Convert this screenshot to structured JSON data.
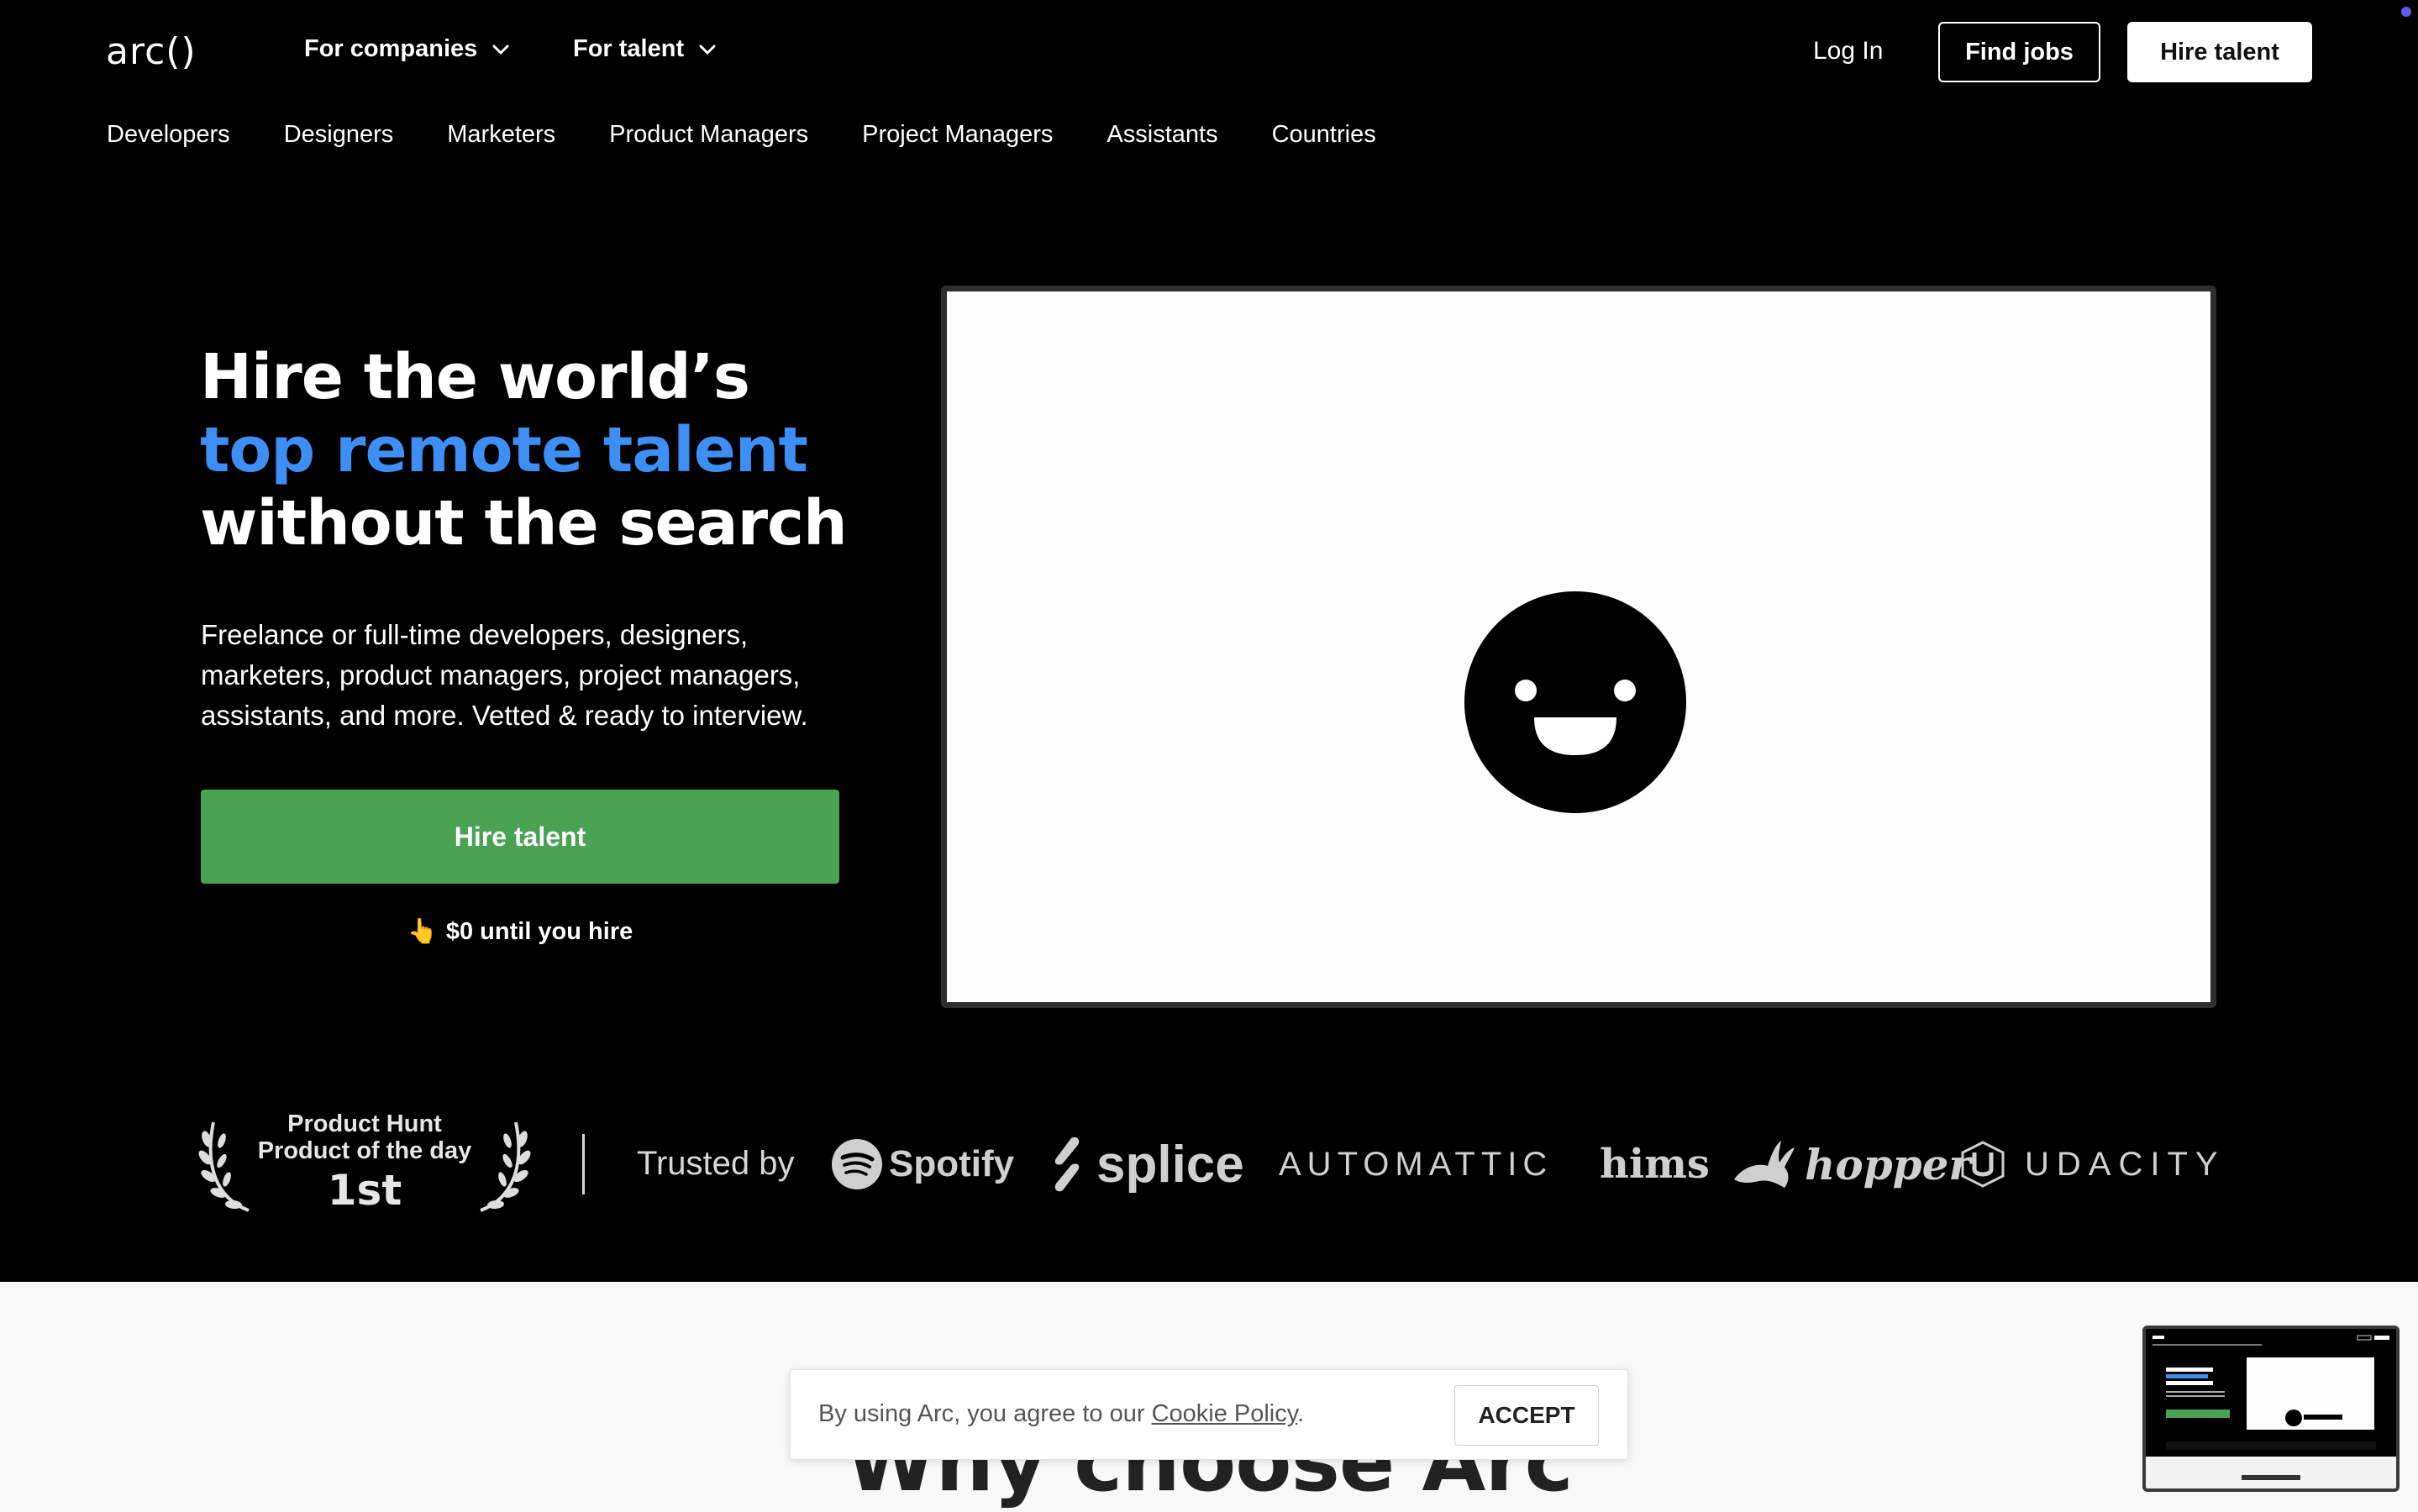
{
  "header": {
    "logo": "arc()",
    "nav_companies": "For companies",
    "nav_talent": "For talent",
    "login": "Log In",
    "find_jobs": "Find jobs",
    "hire_talent": "Hire talent"
  },
  "subnav": [
    "Developers",
    "Designers",
    "Marketers",
    "Product Managers",
    "Project Managers",
    "Assistants",
    "Countries"
  ],
  "hero": {
    "title_line1": "Hire the world’s",
    "title_line2": "top remote talent",
    "title_line3": "without the search",
    "description": "Freelance or full-time developers, designers, marketers, product managers, project managers, assistants, and more. Vetted & ready to interview.",
    "cta": "Hire talent",
    "note_icon": "👆",
    "note": "$0 until you hire"
  },
  "award": {
    "line1": "Product Hunt",
    "line2": "Product of the day",
    "rank": "1st"
  },
  "trusted": {
    "label": "Trusted by",
    "brands": [
      "Spotify",
      "splice",
      "AUTOMATTIC",
      "hims",
      "hopper",
      "UDACITY"
    ]
  },
  "section": {
    "heading": "Why choose Arc"
  },
  "cookie": {
    "text_prefix": "By using Arc, you agree to our ",
    "link": "Cookie Policy",
    "text_suffix": ".",
    "accept": "ACCEPT"
  },
  "colors": {
    "accent_blue": "#3d8ef5",
    "cta_green": "#4aa253",
    "background": "#000000"
  }
}
